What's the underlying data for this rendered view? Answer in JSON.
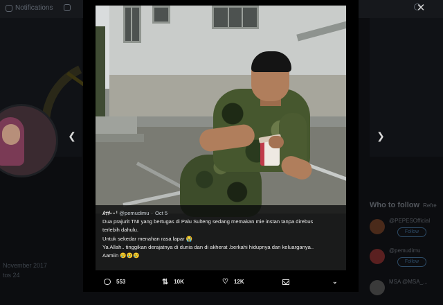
{
  "background": {
    "nav_notifications": "Notifications",
    "side_text_1": "November 2017",
    "side_text_2": "tos 24",
    "follow_title": "Who to follow",
    "follow_refresh": "Refre",
    "follow_items": [
      {
        "name": "@PEPESOfficial",
        "button": "Follow"
      },
      {
        "name": "@pemudimu",
        "button": "Follow"
      },
      {
        "name": "MSA @MSA_...",
        "button": ""
      }
    ]
  },
  "tweet": {
    "user_name": "ʎຠˡ╴╴ˡ",
    "handle": "@pemudimu",
    "separator": "·",
    "date": "Oct 5",
    "lines": [
      "Dua prajurit TNI yang bertugas di Palu Sulteng sedang memakan mie instan tanpa direbus",
      "terlebih dahulu.",
      "Untuk sekedar menahan rasa lapar 😭",
      "Ya Allah.. tinggikan derajatnya di dunia dan di akherat .berkahi hidupnya dan keluarganya..",
      "Aamiin 😢😢😢"
    ],
    "reply_count": "553",
    "retweet_count": "10K",
    "like_count": "12K"
  },
  "icons": {
    "reply": "reply-icon",
    "retweet": "retweet-icon",
    "like": "heart-icon",
    "dm": "mail-icon",
    "more": "chevron-down-icon",
    "prev": "chevron-left-icon",
    "next": "chevron-right-icon",
    "close": "close-icon"
  },
  "colors": {
    "overlay": "#000000",
    "caption_bg": "#08090a",
    "text": "#ececec",
    "link_blue": "#2d4b66"
  }
}
